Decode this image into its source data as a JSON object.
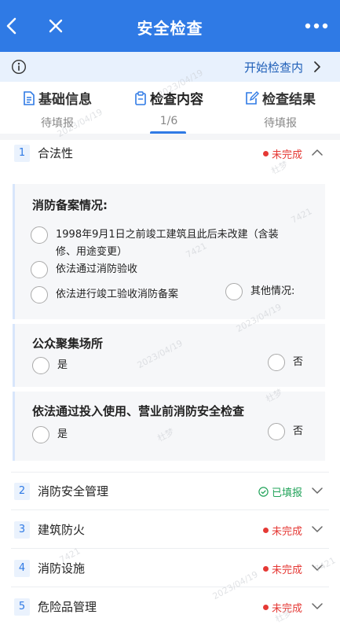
{
  "header": {
    "title": "安全检查",
    "back_icon": "chevron-left-icon",
    "close_icon": "close-icon",
    "more_icon": "more-icon"
  },
  "notice": {
    "link": "开始检查内",
    "icon": "info-icon"
  },
  "tabs": [
    {
      "label": "基础信息",
      "sub": "待填报",
      "icon": "document-icon"
    },
    {
      "label": "检查内容",
      "sub": "1/6",
      "icon": "clipboard-icon"
    },
    {
      "label": "检查结果",
      "sub": "待填报",
      "icon": "edit-icon"
    }
  ],
  "colors": {
    "primary": "#2f7ae5",
    "incomplete": "#e53935",
    "done": "#22a35a"
  },
  "sections": [
    {
      "num": "1",
      "label": "合法性",
      "status": "未完成"
    },
    {
      "num": "2",
      "label": "消防安全管理",
      "status": "已填报"
    },
    {
      "num": "3",
      "label": "建筑防火",
      "status": "未完成"
    },
    {
      "num": "4",
      "label": "消防设施",
      "status": "未完成"
    },
    {
      "num": "5",
      "label": "危险品管理",
      "status": "未完成"
    }
  ],
  "q1": {
    "title": "消防备案情况:",
    "opt1": "1998年9月1日之前竣工建筑且此后未改建（含装",
    "opt1b": "修、用途变更）",
    "opt2": "依法通过消防验收",
    "opt3": "依法进行竣工验收消防备案",
    "opt4": "其他情况:"
  },
  "q2": {
    "title": "公众聚集场所",
    "yes": "是",
    "no": "否"
  },
  "q3": {
    "title": "依法通过投入使用、营业前消防安全检查",
    "yes": "是",
    "no": "否"
  },
  "watermark": {
    "date": "2023/04/19",
    "name": "杜梦",
    "id": "7421"
  }
}
